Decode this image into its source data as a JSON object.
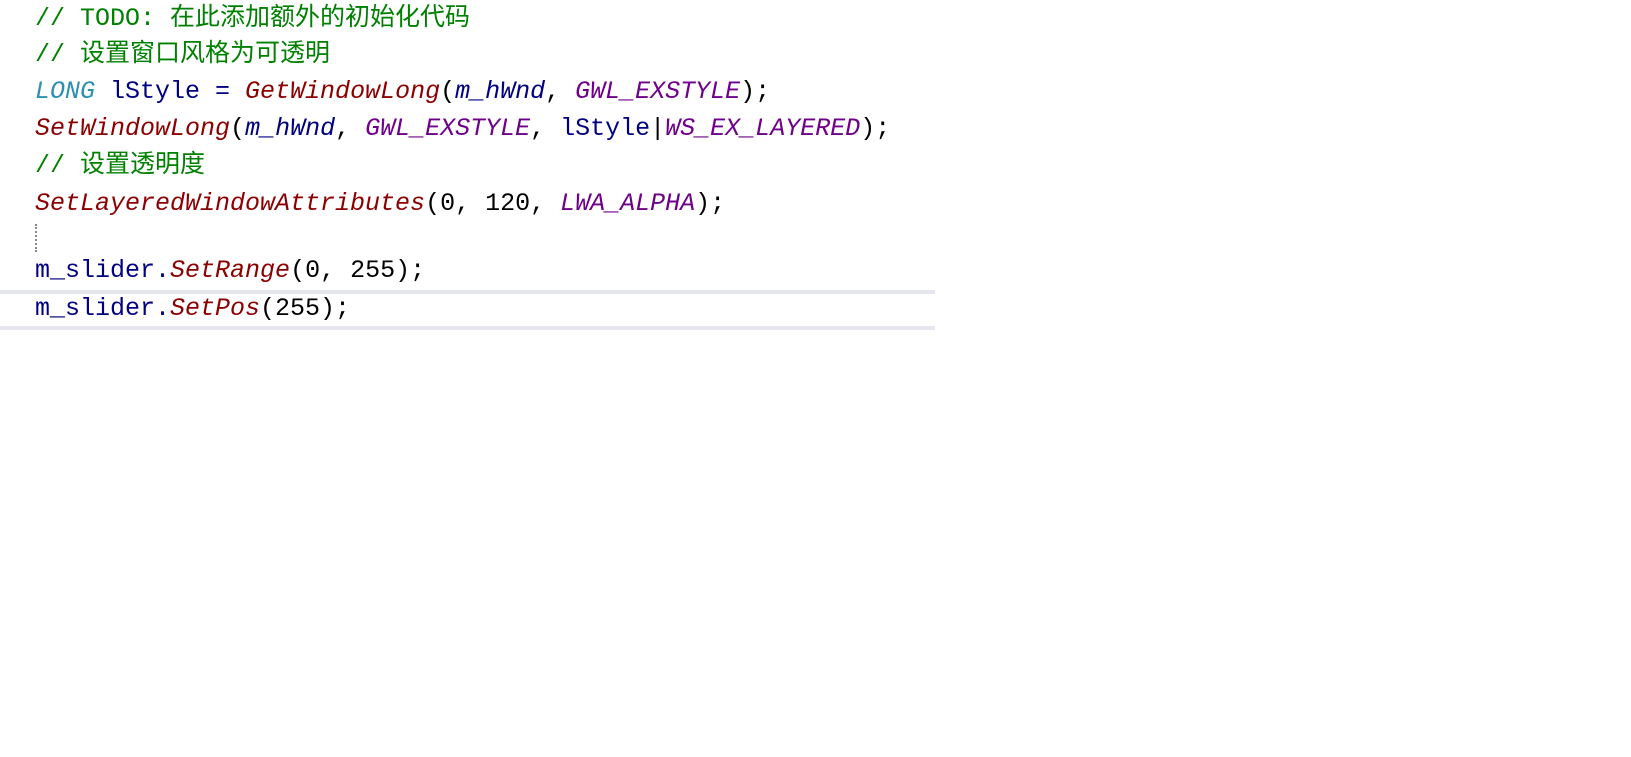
{
  "editor": {
    "current_line": 9,
    "lines": [
      [
        {
          "t": "comment",
          "v": "// TODO: 在此添加额外的初始化代码"
        }
      ],
      [
        {
          "t": "comment",
          "v": "// 设置窗口风格为可透明"
        }
      ],
      [
        {
          "t": "type",
          "v": "LONG"
        },
        {
          "t": "ident",
          "v": " lStyle = "
        },
        {
          "t": "func",
          "v": "GetWindowLong"
        },
        {
          "t": "plain",
          "v": "("
        },
        {
          "t": "var",
          "v": "m_hWnd"
        },
        {
          "t": "plain",
          "v": ", "
        },
        {
          "t": "macro",
          "v": "GWL_EXSTYLE"
        },
        {
          "t": "plain",
          "v": ");"
        }
      ],
      [
        {
          "t": "func",
          "v": "SetWindowLong"
        },
        {
          "t": "plain",
          "v": "("
        },
        {
          "t": "var",
          "v": "m_hWnd"
        },
        {
          "t": "plain",
          "v": ", "
        },
        {
          "t": "macro",
          "v": "GWL_EXSTYLE"
        },
        {
          "t": "plain",
          "v": ", "
        },
        {
          "t": "ident",
          "v": "lStyle"
        },
        {
          "t": "plain",
          "v": "|"
        },
        {
          "t": "macro",
          "v": "WS_EX_LAYERED"
        },
        {
          "t": "plain",
          "v": ");"
        }
      ],
      [
        {
          "t": "comment",
          "v": "// 设置透明度"
        }
      ],
      [
        {
          "t": "func",
          "v": "SetLayeredWindowAttributes"
        },
        {
          "t": "plain",
          "v": "(0, 120, "
        },
        {
          "t": "macro",
          "v": "LWA_ALPHA"
        },
        {
          "t": "plain",
          "v": ");"
        }
      ],
      [],
      [
        {
          "t": "ident",
          "v": "m_slider."
        },
        {
          "t": "func",
          "v": "SetRange"
        },
        {
          "t": "plain",
          "v": "(0, 255);"
        }
      ],
      [
        {
          "t": "ident",
          "v": "m_slider."
        },
        {
          "t": "func",
          "v": "SetPos"
        },
        {
          "t": "plain",
          "v": "(255);"
        }
      ]
    ]
  }
}
